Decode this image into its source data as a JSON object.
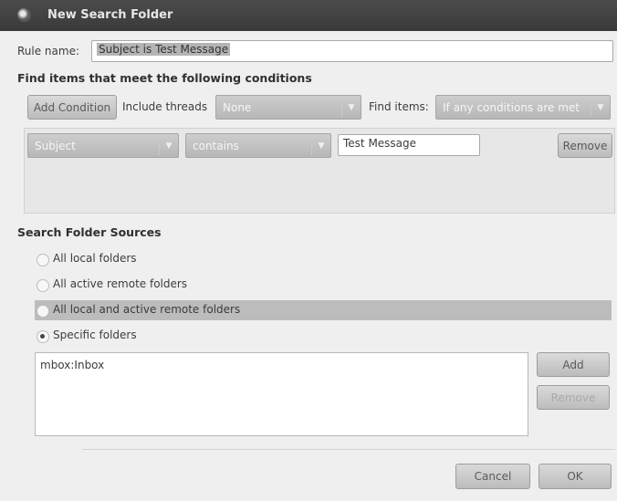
{
  "window": {
    "title": "New Search Folder"
  },
  "rule": {
    "label": "Rule name:",
    "value": "Subject is Test Message"
  },
  "conditions": {
    "heading": "Find items that meet the following conditions",
    "add_condition_label": "Add Condition",
    "include_threads_label": "Include threads",
    "include_threads_value": "None",
    "find_items_label": "Find items:",
    "find_items_value": "If any conditions are met",
    "row": {
      "field": "Subject",
      "operator": "contains",
      "value": "Test Message",
      "remove_label": "Remove"
    }
  },
  "sources": {
    "heading": "Search Folder Sources",
    "options": [
      {
        "label": "All local folders",
        "selected": false
      },
      {
        "label": "All active remote folders",
        "selected": false
      },
      {
        "label": "All local and active remote folders",
        "selected": false
      },
      {
        "label": "Specific folders",
        "selected": true
      }
    ],
    "folders": [
      "mbox:Inbox"
    ],
    "add_label": "Add",
    "remove_label": "Remove"
  },
  "footer": {
    "cancel_label": "Cancel",
    "ok_label": "OK"
  },
  "icons": {
    "window": "app-icon",
    "dropdown": "chevron-down-icon"
  },
  "colors": {
    "titlebar": "#3f3f3f",
    "highlight_row": "#bcbcbc",
    "button": "#c9c9c9"
  }
}
